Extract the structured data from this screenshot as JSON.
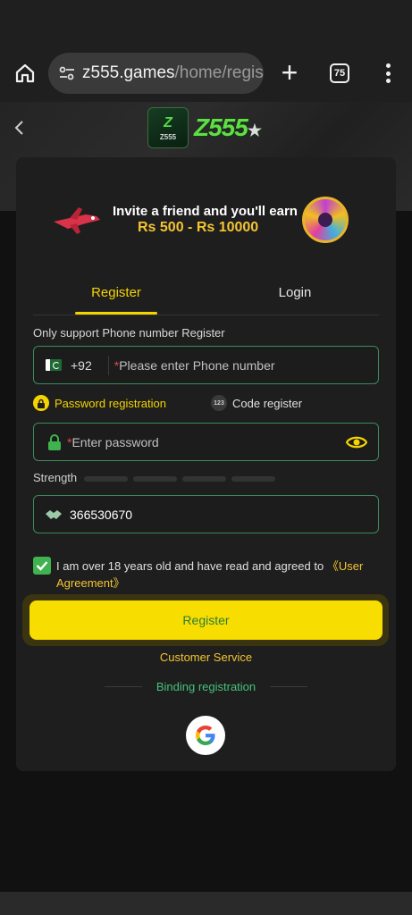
{
  "browser": {
    "url_host": "z555.games",
    "url_path": "/home/regis",
    "plus_label": "+",
    "tab_count": "75"
  },
  "brand": {
    "logo_app_big": "Z",
    "logo_app_small": "Z555",
    "logo_text": "Z555",
    "logo_star": "★"
  },
  "banner": {
    "line1": "Invite a friend and you'll earn",
    "line2": "Rs 500 - Rs 10000"
  },
  "tabs": {
    "register": "Register",
    "login": "Login"
  },
  "form": {
    "hint": "Only support Phone number Register",
    "country_code": "+92",
    "required_mark": "*",
    "phone_placeholder": "Please enter Phone number",
    "mode_password": "Password registration",
    "mode_code_badge": "123",
    "mode_code": "Code register",
    "password_placeholder": "Enter password",
    "strength_label": "Strength",
    "invite_code": "366530670",
    "agree_text": "I am over 18 years old and have read and agreed to",
    "agree_link": "《User Agreement》",
    "register_button": "Register",
    "customer_service": "Customer Service",
    "binding_label": "Binding registration"
  },
  "colors": {
    "accent_yellow": "#f8dd00",
    "accent_green": "#3fb34f",
    "field_border": "#3b8a5e",
    "card_bg": "#1e1e1e"
  }
}
